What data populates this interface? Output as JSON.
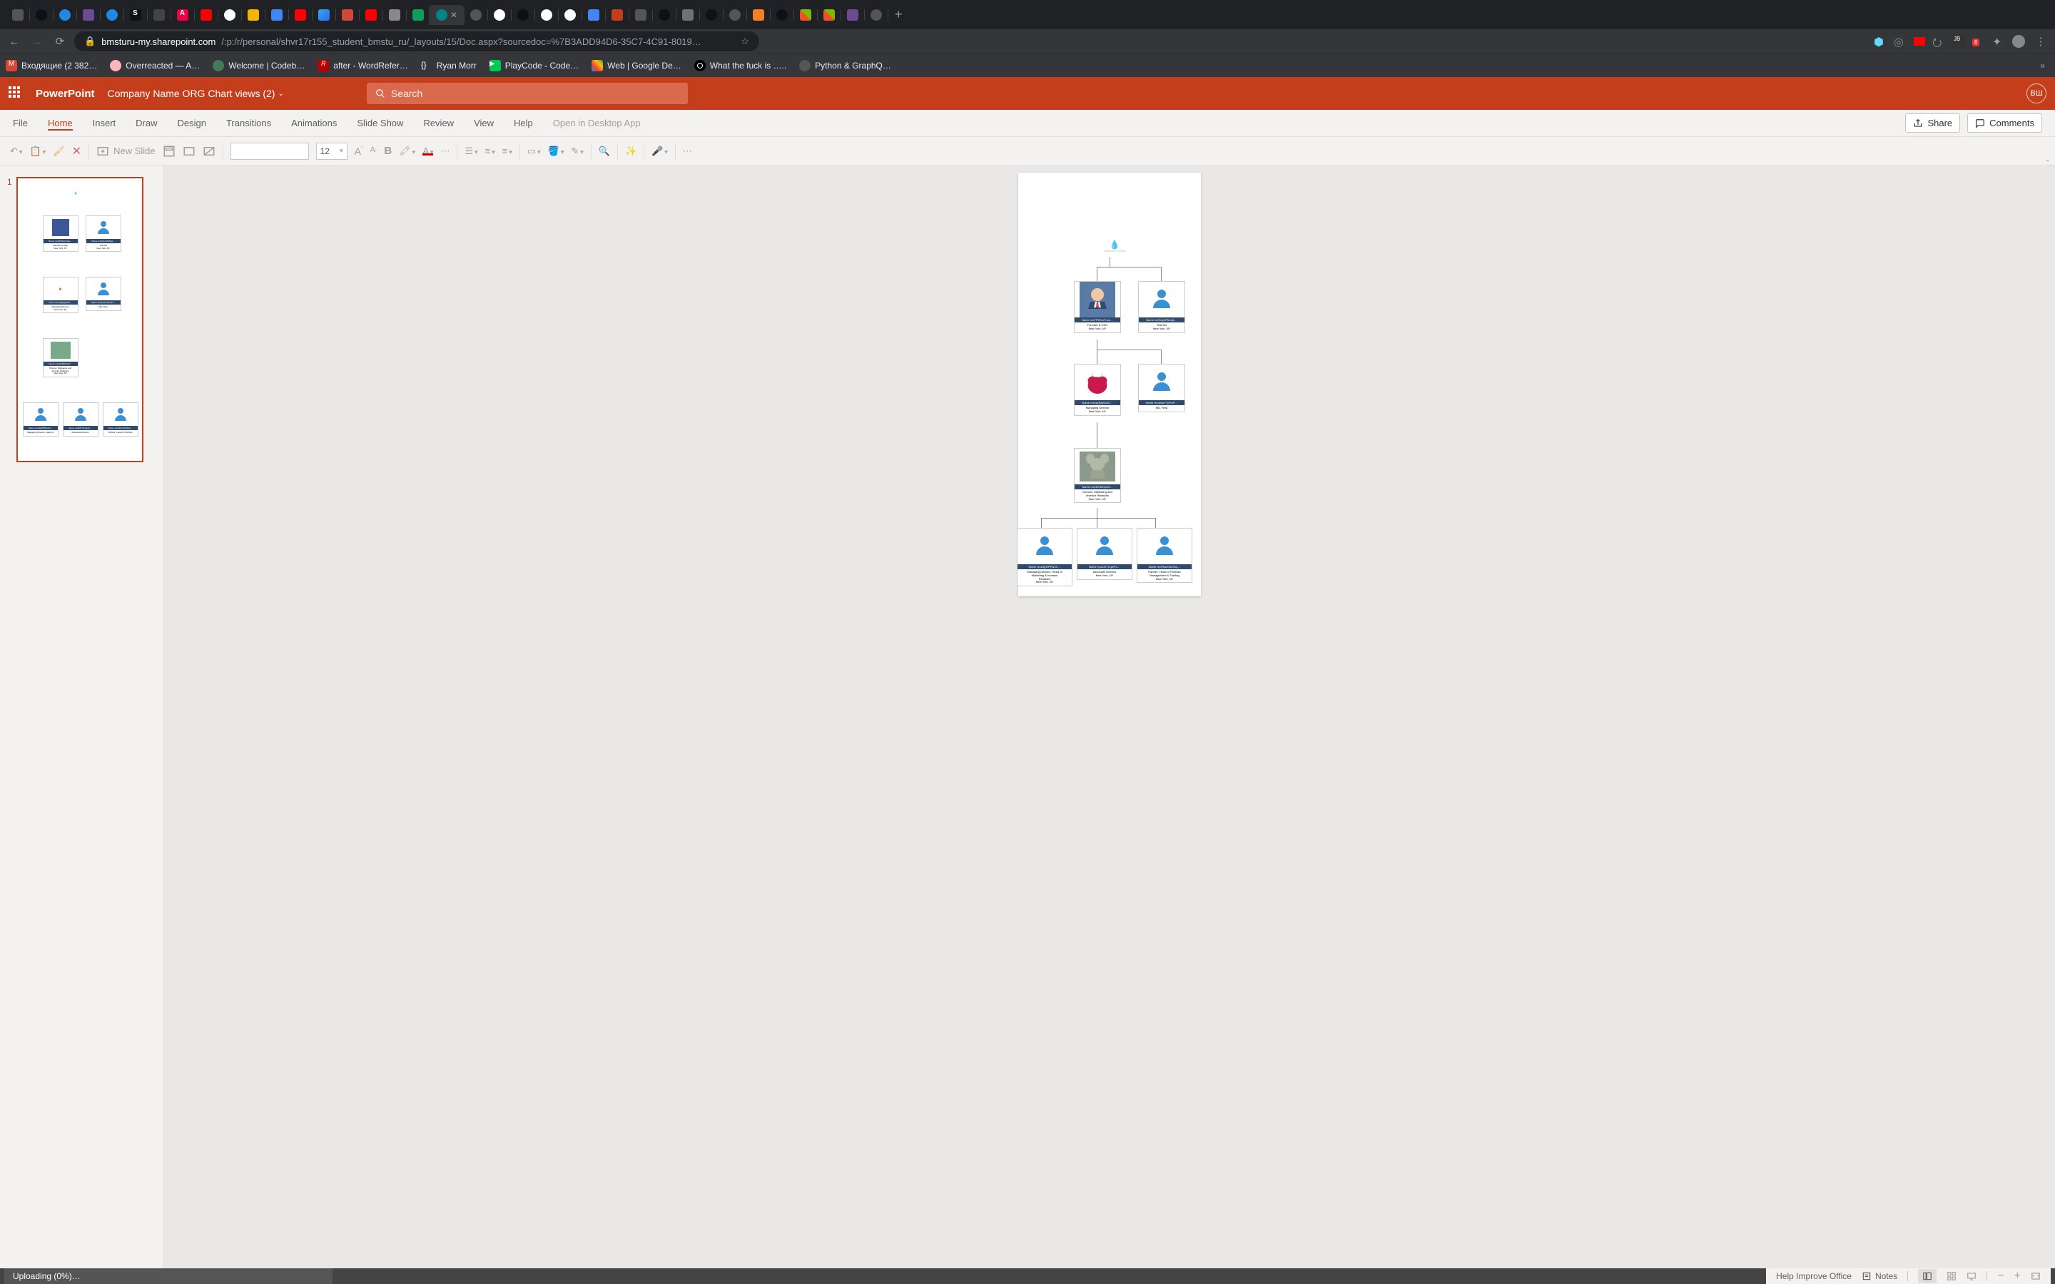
{
  "browser": {
    "url_host": "bmsturu-my.sharepoint.com",
    "url_rest": "/:p:/r/personal/shvr17r155_student_bmstu_ru/_layouts/15/Doc.aspx?sourcedoc=%7B3ADD94D6-35C7-4C91-8019…",
    "bookmarks": [
      {
        "label": "Входящие (2 382…"
      },
      {
        "label": "Overreacted — A…"
      },
      {
        "label": "Welcome | Codeb…"
      },
      {
        "label": "after - WordRefer…"
      },
      {
        "label": "Ryan Morr"
      },
      {
        "label": "PlayCode - Code…"
      },
      {
        "label": "Web  |  Google De…"
      },
      {
        "label": "What the fuck is ….."
      },
      {
        "label": "Python & GraphQ…"
      }
    ]
  },
  "app": {
    "name": "PowerPoint",
    "doc_title": "Company Name ORG Chart views (2)",
    "search_placeholder": "Search",
    "avatar_initials": "ВШ"
  },
  "ribbon": {
    "tabs": [
      "File",
      "Home",
      "Insert",
      "Draw",
      "Design",
      "Transitions",
      "Animations",
      "Slide Show",
      "Review",
      "View",
      "Help"
    ],
    "selected": "Home",
    "open_desktop": "Open in Desktop App",
    "share": "Share",
    "comments": "Comments"
  },
  "toolbar": {
    "new_slide": "New Slide",
    "font_size": "12"
  },
  "slide": {
    "number": "1",
    "org": [
      {
        "id": "n1",
        "header": "Name recFFWVnTnan…",
        "line1": "Founder & CEO",
        "line2": "New York, NY"
      },
      {
        "id": "n2",
        "header": "Name rec9vIpvPAZaj1…",
        "line1": "Test Dis",
        "line2": "New York, NY"
      },
      {
        "id": "n3",
        "header": "Name recxqQMyDw2I…",
        "line1": "Managing Director",
        "line2": "New York, NY"
      },
      {
        "id": "n4",
        "header": "Name rec4nfwTTyFmP…",
        "line1": "MD, Rest",
        "line2": ""
      },
      {
        "id": "n5",
        "header": "Name rec16IrtMOpU6…",
        "line1": "Director, Marketing and",
        "line2": "Investor Relations",
        "line3": "New York, NY"
      },
      {
        "id": "n6",
        "header": "Name recs3pWPPwCIr…",
        "line1": "Managing Director- Head of",
        "line2": "Marketing & Investor",
        "line3": "Relations",
        "line4": "New York, NY"
      },
      {
        "id": "n7",
        "header": "Name rec8JK7CrpeFo…",
        "line1": "Associate Director",
        "line2": "New York, NY"
      },
      {
        "id": "n8",
        "header": "Name recFkwrxItcOGq…",
        "line1": "Partner- Head of Portfolio",
        "line2": "Management & Trading",
        "line3": "New York, NY"
      }
    ]
  },
  "status": {
    "uploading": "Uploading (0%)…",
    "help": "Help Improve Office",
    "notes": "Notes"
  }
}
